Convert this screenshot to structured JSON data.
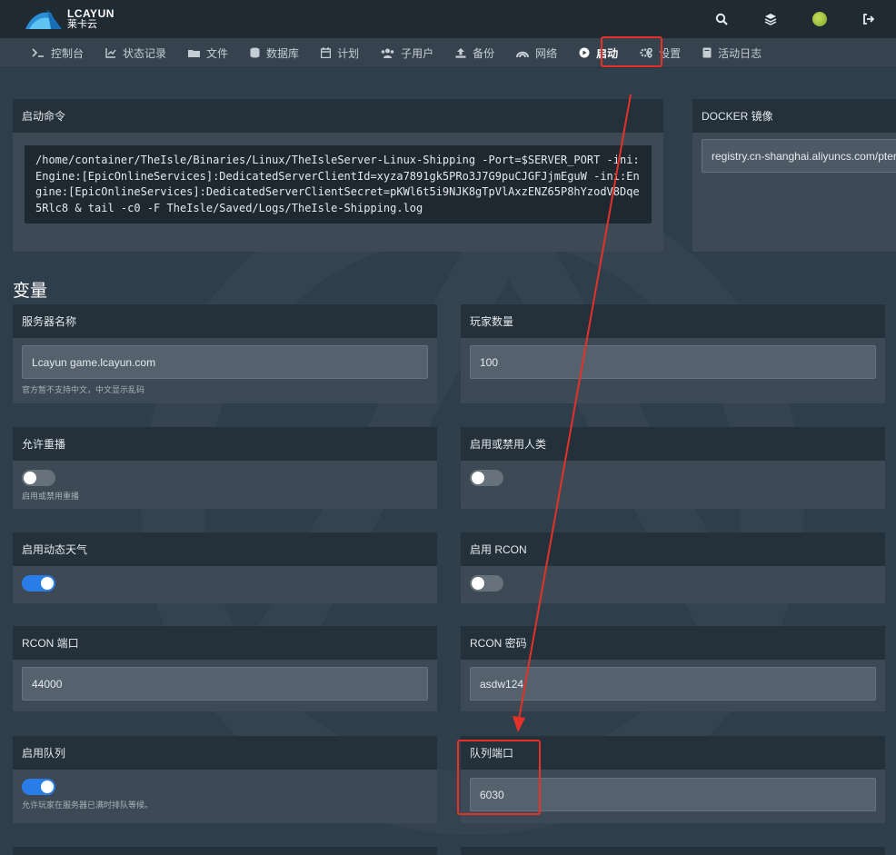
{
  "brand": {
    "name_en": "LCAYUN",
    "name_cn": "莱卡云"
  },
  "topbar": {
    "icons": [
      "search-icon",
      "layers-icon",
      "avatar",
      "logout-icon"
    ]
  },
  "nav": {
    "items": [
      {
        "label": "控制台",
        "icon": "terminal-icon"
      },
      {
        "label": "状态记录",
        "icon": "chart-icon"
      },
      {
        "label": "文件",
        "icon": "folder-icon"
      },
      {
        "label": "数据库",
        "icon": "database-icon"
      },
      {
        "label": "计划",
        "icon": "calendar-icon"
      },
      {
        "label": "子用户",
        "icon": "users-icon"
      },
      {
        "label": "备份",
        "icon": "upload-icon"
      },
      {
        "label": "网络",
        "icon": "network-icon"
      },
      {
        "label": "启动",
        "icon": "play-icon",
        "active": true
      },
      {
        "label": "设置",
        "icon": "gears-icon"
      },
      {
        "label": "活动日志",
        "icon": "book-icon"
      }
    ]
  },
  "startup": {
    "title": "启动命令",
    "command": "/home/container/TheIsle/Binaries/Linux/TheIsleServer-Linux-Shipping -Port=$SERVER_PORT -ini:Engine:[EpicOnlineServices]:DedicatedServerClientId=xyza7891gk5PRo3J7G9puCJGFJjmEguW -ini:Engine:[EpicOnlineServices]:DedicatedServerClientSecret=pKWl6t5i9NJK8gTpVlAxzENZ65P8hYzodV8Dqe5Rlc8 & tail -c0 -F TheIsle/Saved/Logs/TheIsle-Shipping.log"
  },
  "docker": {
    "title": "DOCKER 镜像",
    "value": "registry.cn-shanghai.aliyuncs.com/pter"
  },
  "variables": {
    "title": "变量",
    "server_name": {
      "label": "服务器名称",
      "value": "Lcayun game.lcayun.com",
      "hint": "官方暂不支持中文，中文显示乱码"
    },
    "player_count": {
      "label": "玩家数量",
      "value": "100"
    },
    "allow_replay": {
      "label": "允许重播",
      "on": false,
      "hint": "启用或禁用重播"
    },
    "humans": {
      "label": "启用或禁用人类",
      "on": false
    },
    "dynamic_weather": {
      "label": "启用动态天气",
      "on": true
    },
    "rcon": {
      "label": "启用 RCON",
      "on": false
    },
    "rcon_port": {
      "label": "RCON 端口",
      "value": "44000"
    },
    "rcon_password": {
      "label": "RCON 密码",
      "value": "asdw124"
    },
    "queue": {
      "label": "启用队列",
      "on": true,
      "hint": "允许玩家在服务器已满时排队等候。"
    },
    "queue_port": {
      "label": "队列端口",
      "value": "6030"
    }
  },
  "colors": {
    "accent": "#2a7de9",
    "annotation": "#e53127",
    "panel_head": "#24303a",
    "background": "#2f3e4b"
  }
}
